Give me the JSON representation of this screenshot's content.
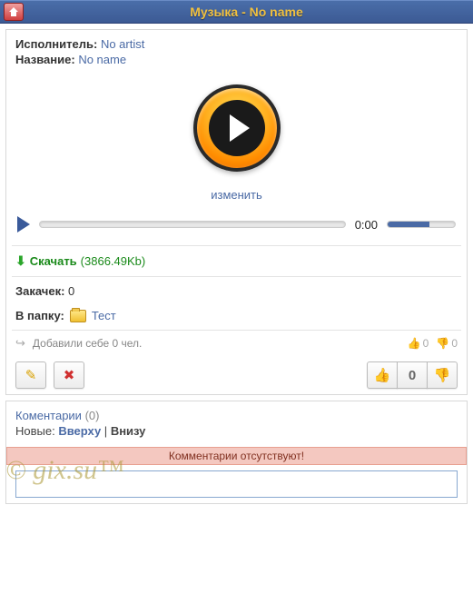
{
  "header": {
    "title": "Музыка - No name"
  },
  "info": {
    "artist_label": "Исполнитель:",
    "artist_value": "No artist",
    "title_label": "Название:",
    "title_value": "No name"
  },
  "player": {
    "change_label": "изменить",
    "time": "0:00"
  },
  "download": {
    "label": "Скачать",
    "size": "(3866.49Kb)"
  },
  "stats": {
    "downloads_label": "Закачек:",
    "downloads_value": "0",
    "folder_label": "В папку:",
    "folder_value": "Тест"
  },
  "social": {
    "added_text": "Добавили себе 0 чел.",
    "up_count": "0",
    "down_count": "0"
  },
  "vote": {
    "score": "0"
  },
  "comments": {
    "title": "Коментарии",
    "count": "(0)",
    "sort_label": "Новые:",
    "sort_top": "Вверху",
    "sort_sep": "|",
    "sort_bottom": "Внизу",
    "empty": "Комментарии отсутствуют!"
  },
  "watermark": "© gix.su™"
}
